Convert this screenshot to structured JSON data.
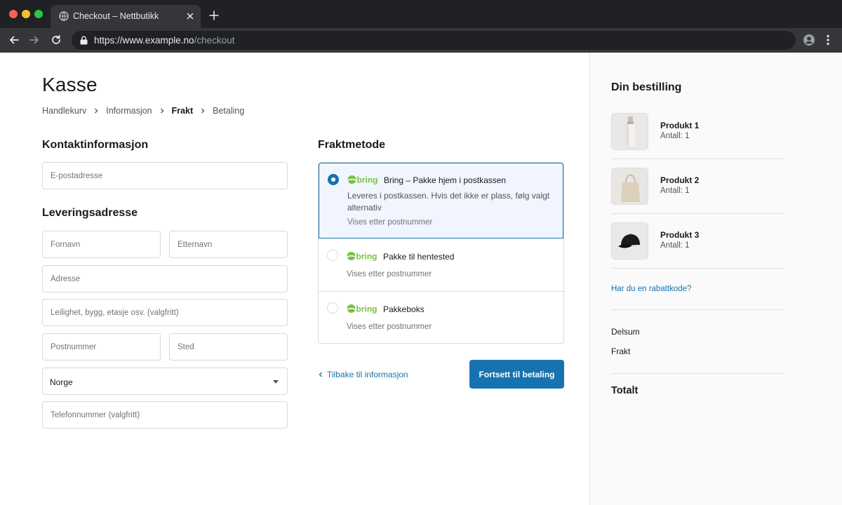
{
  "browser": {
    "tab_title": "Checkout – Nettbutikk",
    "url_host": "https://www.example.no",
    "url_path": "/checkout",
    "traffic_lights": {
      "close": "#ff5f57",
      "minimize": "#febc2e",
      "zoom": "#28c840"
    }
  },
  "page": {
    "title": "Kasse",
    "breadcrumb": [
      "Handlekurv",
      "Informasjon",
      "Frakt",
      "Betaling"
    ],
    "breadcrumb_active_index": 2
  },
  "contact": {
    "heading": "Kontaktinformasjon",
    "email_placeholder": "E-postadresse"
  },
  "address": {
    "heading": "Leveringsadresse",
    "first_name_placeholder": "Fornavn",
    "last_name_placeholder": "Etternavn",
    "address_placeholder": "Adresse",
    "apartment_placeholder": "Leilighet, bygg, etasje osv. (valgfritt)",
    "postcode_placeholder": "Postnummer",
    "city_placeholder": "Sted",
    "country_value": "Norge",
    "phone_placeholder": "Telefonnummer (valgfritt)"
  },
  "shipping": {
    "heading": "Fraktmetode",
    "logo_text": "bring",
    "options": [
      {
        "name": "Bring – Pakke hjem i postkassen",
        "description": "Leveres i postkassen. Hvis det ikke er plass, følg valgt alternativ",
        "note": "Vises etter postnummer",
        "selected": true
      },
      {
        "name": "Pakke til hentested",
        "description": "",
        "note": "Vises etter postnummer",
        "selected": false
      },
      {
        "name": "Pakkeboks",
        "description": "",
        "note": "Vises etter postnummer",
        "selected": false
      }
    ]
  },
  "actions": {
    "back_label": "Tilbake til informasjon",
    "continue_label": "Fortsett til betaling"
  },
  "order": {
    "heading": "Din bestilling",
    "products": [
      {
        "name": "Produkt 1",
        "qty": "Antall: 1",
        "icon": "bottle-icon"
      },
      {
        "name": "Produkt 2",
        "qty": "Antall: 1",
        "icon": "tote-bag-icon"
      },
      {
        "name": "Produkt 3",
        "qty": "Antall: 1",
        "icon": "cap-icon"
      }
    ],
    "discount_link": "Har du en rabattkode?",
    "subtotal_label": "Delsum",
    "shipping_label": "Frakt",
    "total_label": "Totalt"
  },
  "colors": {
    "accent": "#1773b0",
    "selected_bg": "#f0f5ff",
    "bring_green": "#7bc144",
    "browser_dark": "#202124",
    "browser_tab": "#35363a"
  }
}
